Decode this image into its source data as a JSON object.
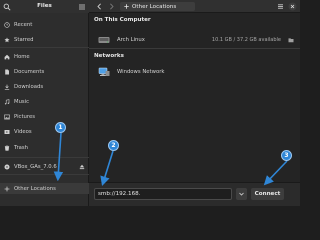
{
  "app": {
    "title": "Files"
  },
  "sidebar": {
    "items": [
      {
        "label": "Recent",
        "icon": "clock-icon"
      },
      {
        "label": "Starred",
        "icon": "star-icon"
      },
      {
        "label": "Home",
        "icon": "home-icon"
      },
      {
        "label": "Documents",
        "icon": "document-icon"
      },
      {
        "label": "Downloads",
        "icon": "download-icon"
      },
      {
        "label": "Music",
        "icon": "music-icon"
      },
      {
        "label": "Pictures",
        "icon": "picture-icon"
      },
      {
        "label": "Videos",
        "icon": "video-icon"
      },
      {
        "label": "Trash",
        "icon": "trash-icon"
      }
    ],
    "device": {
      "label": "VBox_GAs_7.0.6",
      "icon": "disc-icon"
    },
    "other": {
      "label": "Other Locations",
      "icon": "plus-icon"
    }
  },
  "header": {
    "location": "Other Locations"
  },
  "main": {
    "computer_section": "On This Computer",
    "computer_item": {
      "name": "Arch Linux",
      "meta": "10.1 GB / 37.2 GB available"
    },
    "networks_section": "Networks",
    "network_item": {
      "name": "Windows Network"
    }
  },
  "bottom": {
    "server_address": "smb://192.168.",
    "connect_label": "Connect"
  },
  "annotations": {
    "badge1": "1",
    "badge2": "2",
    "badge3": "3",
    "color": "#2f86d6"
  }
}
